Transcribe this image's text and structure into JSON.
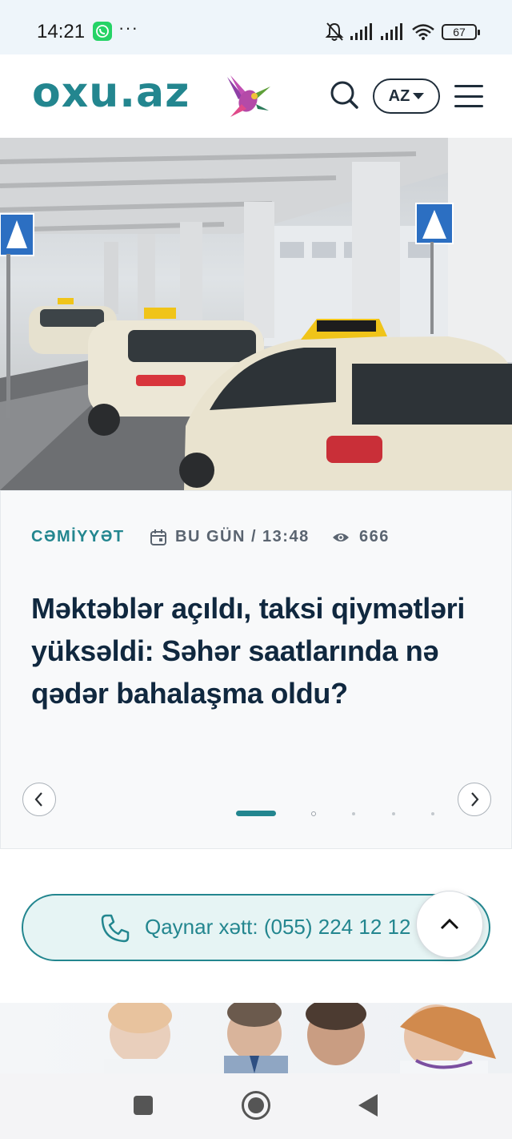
{
  "status_bar": {
    "time": "14:21",
    "dots": "···",
    "battery": "67",
    "icons": [
      "whatsapp-icon",
      "bell-off-icon",
      "signal-icon",
      "signal-icon",
      "wifi-icon",
      "battery-icon"
    ]
  },
  "header": {
    "logo": "oxu.az",
    "lang": "AZ",
    "icons": [
      "search-icon",
      "chevron-down-icon",
      "menu-icon"
    ]
  },
  "article": {
    "category": "CƏMİYYƏT",
    "date": "BU GÜN / 13:48",
    "views": "666",
    "headline": "Məktəblər açıldı, taksi qiymətləri yüksəldi: Səhər saatlarında nə qədər bahalaşma oldu?",
    "slides_total": 5,
    "active_slide": 1
  },
  "hotline": {
    "text": "Qaynar xətt: (055) 224 12 12"
  },
  "colors": {
    "brand": "#23868f",
    "headline": "#10283f"
  }
}
